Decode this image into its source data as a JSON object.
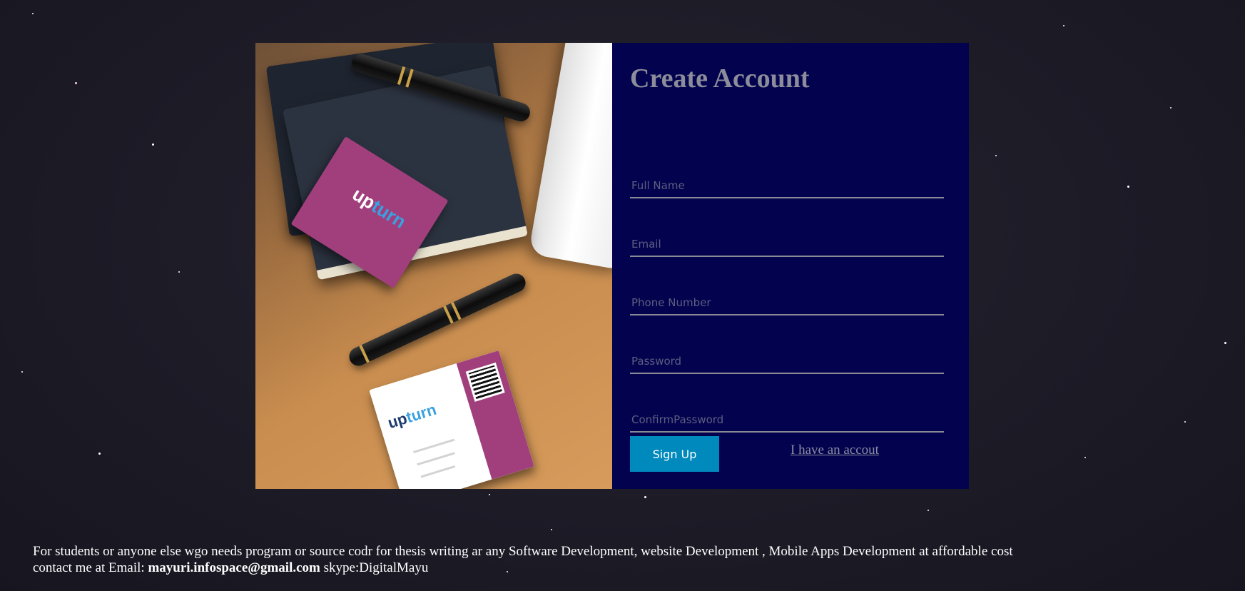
{
  "form": {
    "title": "Create Account",
    "fields": {
      "full_name": {
        "placeholder": "Full Name"
      },
      "email": {
        "placeholder": "Email"
      },
      "phone": {
        "placeholder": "Phone Number"
      },
      "password": {
        "placeholder": "Password"
      },
      "confirm_password": {
        "placeholder": "ConfirmPassword"
      }
    },
    "signup_label": "Sign Up",
    "login_link": "I have an accout"
  },
  "footer": {
    "line1": "For students or anyone else wgo needs program or source codr for thesis writing ar any Software Development, website Development , Mobile Apps Development at affordable cost",
    "contact_prefix": "contact me at Email:",
    "email": "mayuri.infospace@gmail.com",
    "skype": "skype:DigitalMayu"
  },
  "colors": {
    "form_panel_bg": "#02024f",
    "signup_button": "#0089bd",
    "card_brand": "#a13f7d"
  }
}
